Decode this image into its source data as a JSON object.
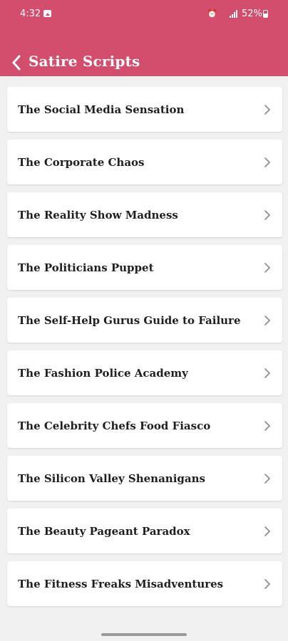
{
  "status_bar": {
    "time": "4:32",
    "battery": "52%"
  },
  "header": {
    "title": "Satire Scripts"
  },
  "items": [
    {
      "label": "The Social Media Sensation"
    },
    {
      "label": "The Corporate Chaos"
    },
    {
      "label": "The Reality Show Madness"
    },
    {
      "label": "The Politicians Puppet"
    },
    {
      "label": "The Self-Help Gurus Guide to Failure"
    },
    {
      "label": "The Fashion Police Academy"
    },
    {
      "label": "The Celebrity Chefs Food Fiasco"
    },
    {
      "label": "The Silicon Valley Shenanigans"
    },
    {
      "label": "The Beauty Pageant Paradox"
    },
    {
      "label": "The Fitness Freaks Misadventures"
    }
  ],
  "icons": {
    "back": "chevron-left-icon",
    "item": "chevron-right-icon",
    "gallery": "image-icon",
    "alarm": "alarm-icon",
    "signal": "signal-icon",
    "battery": "battery-icon"
  },
  "colors": {
    "accent": "#d34d6c",
    "background": "#f1f1f1",
    "card": "#ffffff",
    "text": "#1f1f1f"
  }
}
